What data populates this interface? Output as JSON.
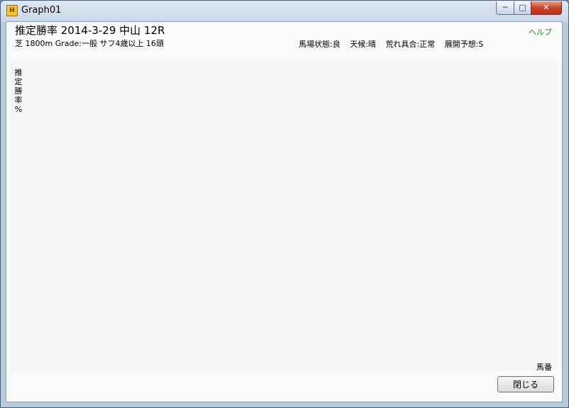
{
  "window": {
    "title": "Graph01",
    "icon": "app-icon",
    "controls": {
      "minimize": "minimize-icon",
      "maximize": "maximize-icon",
      "close": "close-icon"
    }
  },
  "header": {
    "title": "推定勝率  2014-3-29  中山  12R",
    "subtitle": "芝 1800m  Grade:一般  サフ4歳以上  16頭",
    "conditions": [
      "馬場状態:良",
      "天候:晴",
      "荒れ具合:正常",
      "展開予想:S"
    ],
    "help": "ヘルプ"
  },
  "chart_data": {
    "type": "bar",
    "ylabel": "推定勝率%",
    "xlabel": "馬番",
    "categories": [],
    "values": []
  },
  "footer": {
    "close_label": "閉じる"
  },
  "colors": {
    "help_link": "#228b22",
    "background": "#fafafa"
  }
}
